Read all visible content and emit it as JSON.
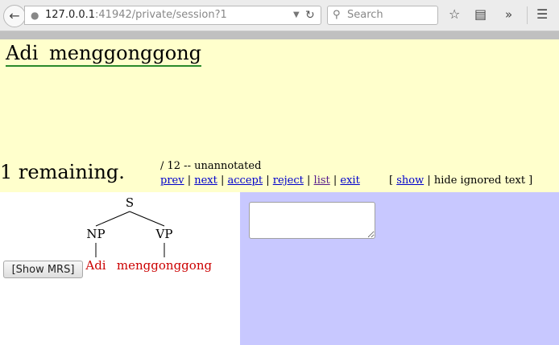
{
  "browser": {
    "url_prefix": "127.0.0.1",
    "url_rest": ":41942/private/session?1",
    "search_placeholder": "Search"
  },
  "page": {
    "sentence": "Adi  menggonggong",
    "remaining": "1 remaining.",
    "status": "/ 12 -- unannotated",
    "nav": {
      "prev": "prev",
      "next": "next",
      "accept": "accept",
      "reject": "reject",
      "list": "list",
      "exit": "exit",
      "separator": " | "
    },
    "toggle": {
      "open_bracket": "[ ",
      "show": "show",
      "rest": " | hide ignored text ]"
    },
    "tree": {
      "root": "S",
      "children": [
        "NP",
        "VP"
      ],
      "words": [
        "Adi",
        "menggonggong"
      ],
      "word_color": "#cc0000"
    },
    "show_mrs_label": "[Show MRS]",
    "colors": {
      "top_panel": "#ffffcc",
      "right_panel": "#c8c8ff",
      "link": "#0000cc",
      "visited_link": "#551a8b",
      "sentence_underline": "#2a8a2a"
    }
  }
}
